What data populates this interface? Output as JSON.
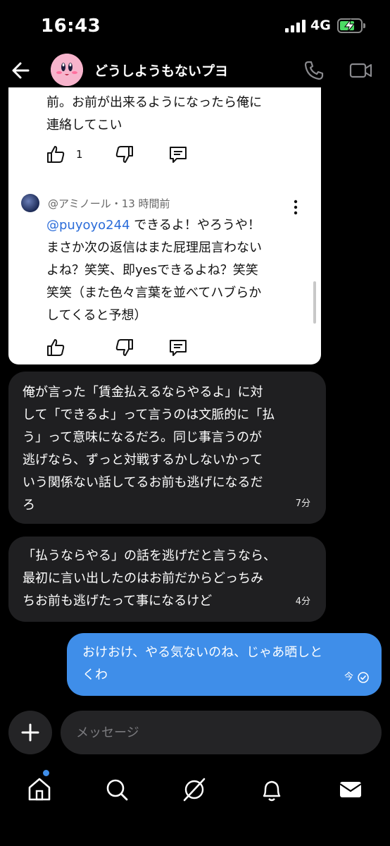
{
  "status": {
    "time": "16:43",
    "network": "4G"
  },
  "header": {
    "title": "どうしようもないプヨ"
  },
  "card": {
    "text_lines": [
      "前。お前が出来るようになったら俺に",
      "連絡してこい"
    ],
    "like_count": "1",
    "reply": {
      "meta": "@アミノール・13 時間前",
      "mention": "@puyoyo244",
      "text_first": " できるよ！やろうや！",
      "text_lines": [
        "まさか次の返信はまた屁理屈言わない",
        "よね？笑笑、即yesできるよね？笑笑",
        "笑笑（また色々言葉を並べてハブらか",
        "してくると予想）"
      ]
    }
  },
  "messages": [
    {
      "lines": [
        "俺が言った「賃金払えるならやるよ」に対",
        "して「できるよ」って言うのは文脈的に「払",
        "う」って意味になるだろ。同じ事言うのが",
        "逃げなら、ずっと対戦するかしないかって",
        "いう関係ない話してるお前も逃げになるだ",
        "ろ"
      ],
      "time": "7分"
    },
    {
      "lines": [
        "「払うならやる」の話を逃げだと言うなら、",
        "最初に言い出したのはお前だからどっちみ",
        "ちお前も逃げたって事になるけど"
      ],
      "time": "4分"
    },
    {
      "lines": [
        "おけおけ、やる気ないのね、じゃあ晒しと",
        "くわ"
      ],
      "time": "今"
    }
  ],
  "composer": {
    "placeholder": "メッセージ"
  },
  "colors": {
    "accent": "#3f8ee9",
    "bubble_dark": "#1f1f21",
    "mention": "#2b6cd9"
  },
  "tabs": [
    {
      "name": "home-icon"
    },
    {
      "name": "search-icon"
    },
    {
      "name": "grok-icon"
    },
    {
      "name": "bell-icon"
    },
    {
      "name": "mail-icon"
    }
  ]
}
